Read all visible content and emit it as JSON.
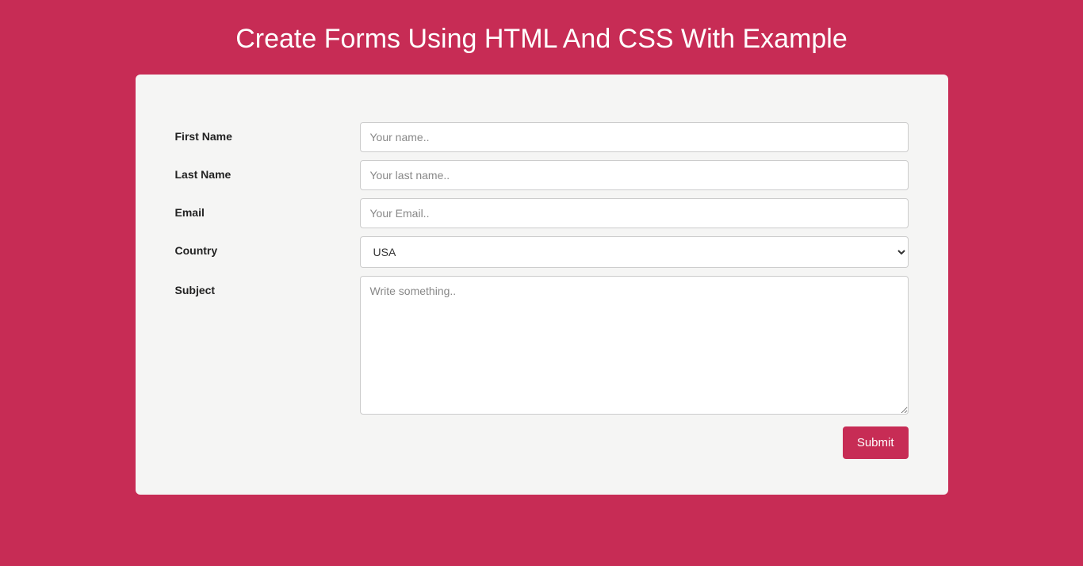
{
  "header": {
    "title": "Create Forms Using HTML And CSS With Example"
  },
  "form": {
    "fields": {
      "fname": {
        "label": "First Name",
        "placeholder": "Your name..",
        "value": ""
      },
      "lname": {
        "label": "Last Name",
        "placeholder": "Your last name..",
        "value": ""
      },
      "email": {
        "label": "Email",
        "placeholder": "Your Email..",
        "value": ""
      },
      "country": {
        "label": "Country",
        "selected": "USA"
      },
      "subject": {
        "label": "Subject",
        "placeholder": "Write something..",
        "value": ""
      }
    },
    "submit_label": "Submit"
  }
}
